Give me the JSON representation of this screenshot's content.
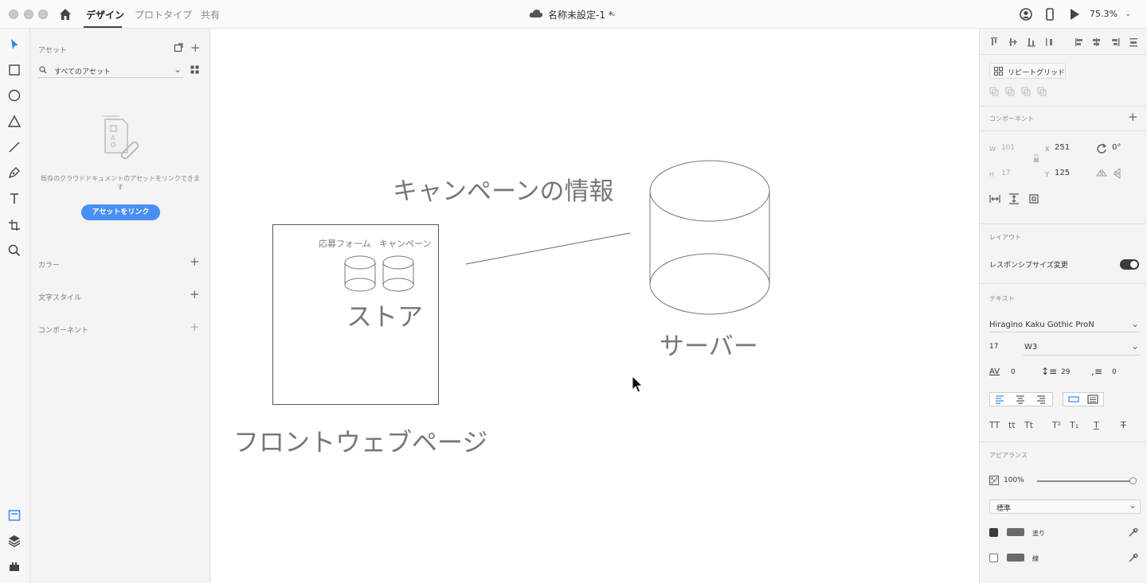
{
  "titlebar": {
    "tabs": [
      "デザイン",
      "プロトタイプ",
      "共有"
    ],
    "document_title": "名称未設定-1 *",
    "zoom": "75.3%"
  },
  "assets": {
    "title": "アセット",
    "search_placeholder": "すべてのアセット",
    "empty_message": "既存のクラウドドキュメントのアセットをリンクできます",
    "link_button": "アセットをリンク",
    "sections": [
      "カラー",
      "文字スタイル",
      "コンポーネント"
    ]
  },
  "canvas": {
    "campaign_title": "キャンペーンの情報",
    "form_label": "応募フォーム",
    "campaign_label": "キャンペーン",
    "store_label": "ストア",
    "server_label": "サーバー",
    "front_label": "フロントウェブページ"
  },
  "properties": {
    "repeat_grid": "リピートグリッド",
    "component": "コンポーネント",
    "w_label": "W",
    "w_value": "101",
    "h_label": "H",
    "h_value": "17",
    "x_label": "X",
    "x_value": "251",
    "y_label": "Y",
    "y_value": "125",
    "rotation": "0°",
    "layout": "レイアウト",
    "responsive": "レスポンシブサイズ変更",
    "text_section": "テキスト",
    "font_family": "Hiragino Kaku Gothic ProN",
    "font_size": "17",
    "font_weight": "W3",
    "char_spacing": "0",
    "line_spacing": "29",
    "para_spacing": "0",
    "appearance": "アピアランス",
    "opacity": "100%",
    "blend_mode": "標準",
    "fill": "塗り",
    "border": "線"
  },
  "colors": {
    "accent": "#4b8ff5",
    "canvas_bg": "#ffffff",
    "panel_bg": "#f4f4f4"
  }
}
